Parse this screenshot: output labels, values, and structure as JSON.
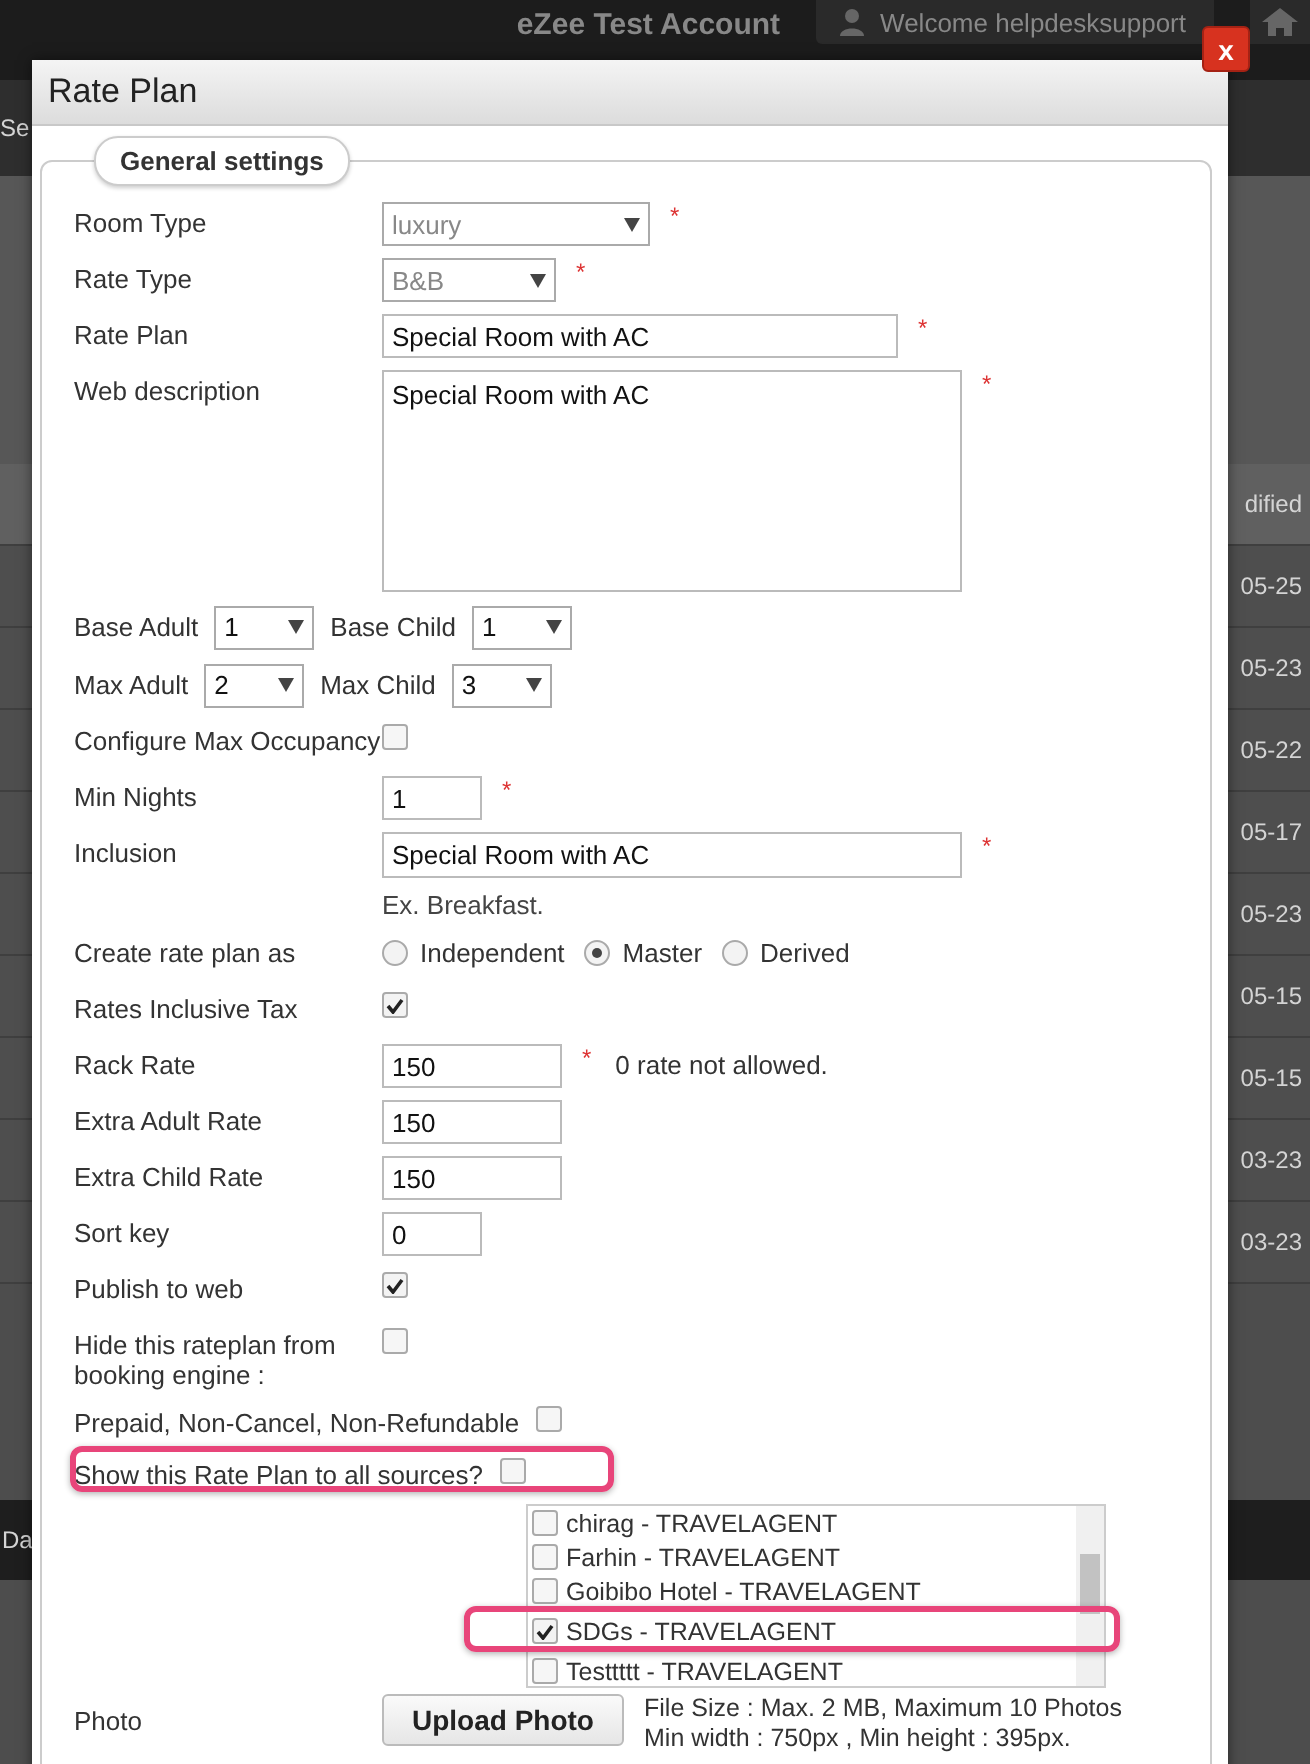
{
  "topbar": {
    "account": "eZee Test Account",
    "welcome": "Welcome helpdesksupport"
  },
  "background": {
    "tab_fragment": "Se",
    "table_rows": [
      {
        "right": "dified"
      },
      {
        "right": "05-25"
      },
      {
        "right": "05-23"
      },
      {
        "right": "05-22"
      },
      {
        "right": "05-17"
      },
      {
        "right": "05-23"
      },
      {
        "right": "05-15"
      },
      {
        "right": "05-15"
      },
      {
        "right": "03-23"
      },
      {
        "right": "03-23"
      }
    ],
    "footer_fragment": "Da"
  },
  "dialog": {
    "title": "Rate Plan",
    "close": "x",
    "legend": "General settings",
    "fields": [
      {
        "kind": "select",
        "label": "Room Type",
        "value": "luxury",
        "disabled": true,
        "mark": "*"
      },
      {
        "kind": "select",
        "label": "Rate Type",
        "value": "B&B",
        "disabled": true,
        "mark": "*"
      },
      {
        "kind": "text",
        "label": "Rate Plan",
        "value": "Special Room with AC",
        "mark": "*"
      },
      {
        "kind": "textarea",
        "label": "Web description",
        "value": "Special Room with AC",
        "mark": "*"
      },
      {
        "kind": "pair",
        "items": [
          {
            "label": "Base Adult",
            "value": "1"
          },
          {
            "label": "Base Child",
            "value": "1"
          }
        ]
      },
      {
        "kind": "pair",
        "items": [
          {
            "label": "Max Adult",
            "value": "2"
          },
          {
            "label": "Max Child",
            "value": "3"
          }
        ]
      },
      {
        "kind": "checkbox",
        "label": "Configure Max Occupancy",
        "checked": false
      },
      {
        "kind": "text",
        "label": "Min Nights",
        "value": "1",
        "mark": "*"
      },
      {
        "kind": "line",
        "label": "Inclusion",
        "value": "Special Room with AC",
        "hint": "Ex. Breakfast.",
        "mark": "*"
      },
      {
        "kind": "radio",
        "label": "Create rate plan as",
        "options": [
          {
            "label": "Independent",
            "selected": false
          },
          {
            "label": "Master",
            "selected": true
          },
          {
            "label": "Derived",
            "selected": false
          }
        ]
      },
      {
        "kind": "checkbox",
        "label": "Rates Inclusive Tax",
        "checked": true
      },
      {
        "kind": "text",
        "label": "Rack Rate",
        "value": "150",
        "mark": "*",
        "note": "0 rate not allowed."
      },
      {
        "kind": "text",
        "label": "Extra Adult Rate",
        "value": "150"
      },
      {
        "kind": "text",
        "label": "Extra Child Rate",
        "value": "150"
      },
      {
        "kind": "text",
        "label": "Sort key",
        "value": "0"
      },
      {
        "kind": "checkbox",
        "label": "Publish to web",
        "checked": true
      },
      {
        "kind": "checkbox",
        "label": "Hide this rateplan from booking engine :",
        "checked": false
      },
      {
        "kind": "inline_checkbox",
        "label": "Prepaid, Non-Cancel, Non-Refundable",
        "checked": false,
        "highlighted": false
      },
      {
        "kind": "inline_checkbox",
        "label": "Show this Rate Plan to all sources?",
        "checked": false,
        "highlighted": true
      },
      {
        "kind": "sources",
        "items": [
          {
            "label": "chirag - TRAVELAGENT",
            "checked": false,
            "highlighted": false
          },
          {
            "label": "Farhin - TRAVELAGENT",
            "checked": false,
            "highlighted": false
          },
          {
            "label": "Goibibo Hotel - TRAVELAGENT",
            "checked": false,
            "highlighted": false
          },
          {
            "label": "SDGs - TRAVELAGENT",
            "checked": true,
            "highlighted": true
          },
          {
            "label": "Testtttt - TRAVELAGENT",
            "checked": false,
            "highlighted": false
          }
        ]
      },
      {
        "kind": "photo",
        "label": "Photo",
        "button": "Upload Photo",
        "info": [
          "File Size : Max. 2 MB, Maximum 10 Photos",
          "Min width : 750px , Min height : 395px."
        ]
      }
    ]
  }
}
